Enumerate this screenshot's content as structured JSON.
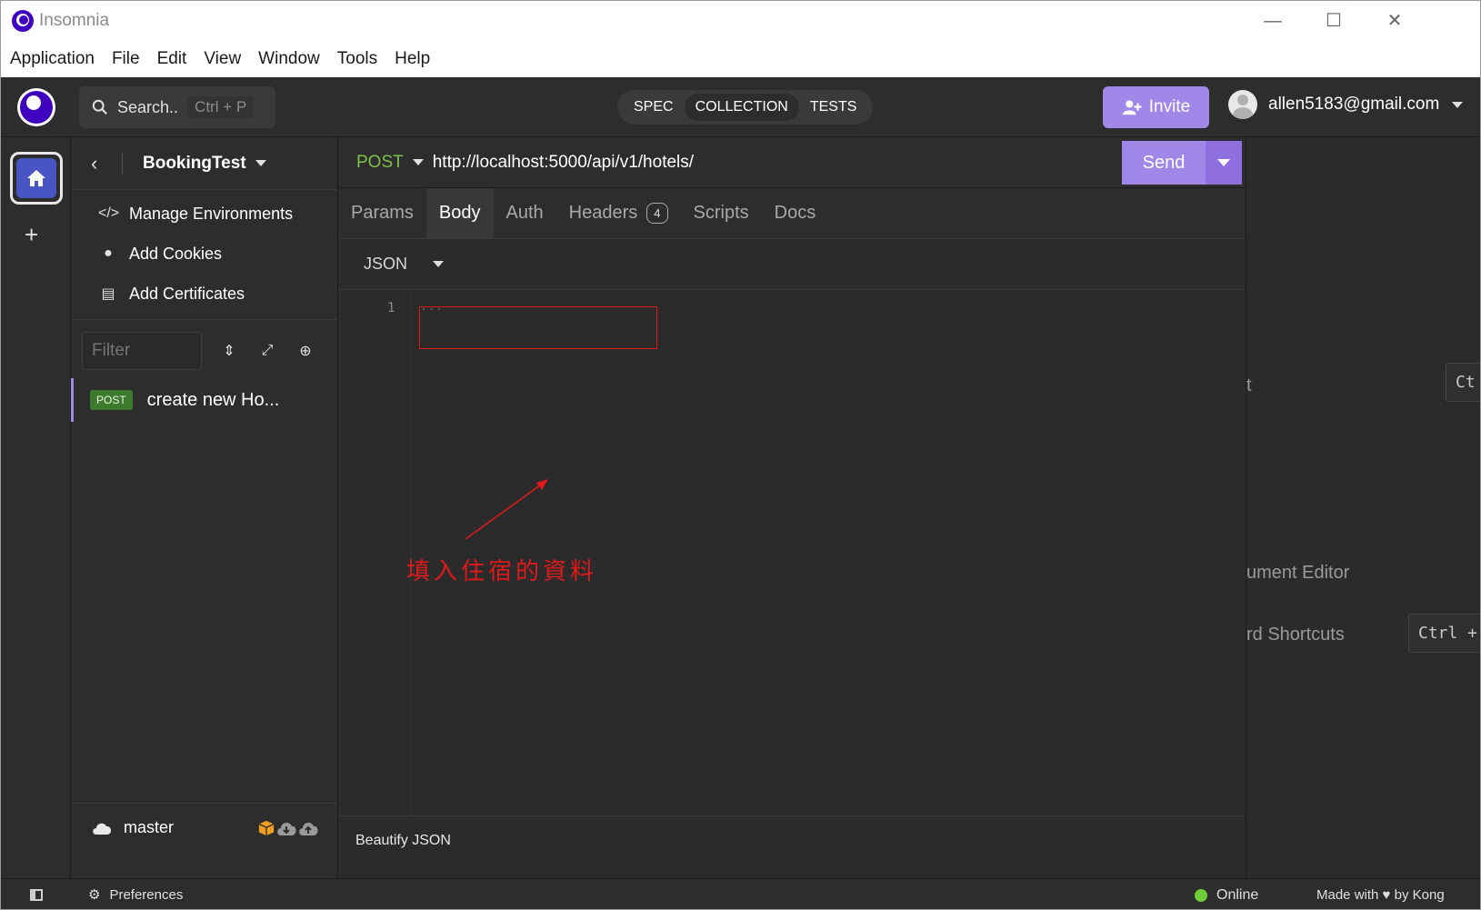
{
  "window": {
    "title": "Insomnia",
    "controls": {
      "minimize": "—",
      "maximize": "☐",
      "close": "✕"
    }
  },
  "menubar": [
    "Application",
    "File",
    "Edit",
    "View",
    "Window",
    "Tools",
    "Help"
  ],
  "header": {
    "search_label": "Search..",
    "search_shortcut": "Ctrl + P",
    "mode_tabs": [
      "SPEC",
      "COLLECTION",
      "TESTS"
    ],
    "active_mode": "COLLECTION",
    "invite_label": "Invite",
    "user_email": "allen5183@gmail.com"
  },
  "sidebar": {
    "project_name": "BookingTest",
    "actions": [
      {
        "label": "Manage Environments",
        "icon": "code-icon"
      },
      {
        "label": "Add Cookies",
        "icon": "cookie-icon"
      },
      {
        "label": "Add Certificates",
        "icon": "certificate-icon"
      }
    ],
    "filter_placeholder": "Filter",
    "requests": [
      {
        "method": "POST",
        "name": "create new Ho..."
      }
    ],
    "branch": "master"
  },
  "request": {
    "method": "POST",
    "url": "http://localhost:5000/api/v1/hotels/",
    "send_label": "Send",
    "tabs": [
      {
        "label": "Params"
      },
      {
        "label": "Body",
        "active": true
      },
      {
        "label": "Auth"
      },
      {
        "label": "Headers",
        "count": "4"
      },
      {
        "label": "Scripts"
      },
      {
        "label": "Docs"
      }
    ],
    "body_type": "JSON",
    "editor": {
      "line_number": "1",
      "placeholder": "..."
    },
    "annotation": "填入住宿的資料",
    "footer_action": "Beautify JSON"
  },
  "response_pane": {
    "fragments": [
      "t",
      "ument Editor",
      "rd Shortcuts"
    ],
    "kbd_fragments": [
      "Ct",
      "Ctrl +"
    ]
  },
  "statusbar": {
    "preferences_label": "Preferences",
    "status_label": "Online",
    "made_with_prefix": "Made with",
    "made_with_suffix": "by Kong"
  },
  "colors": {
    "accent": "#a088e8",
    "method_post": "#7ec14a",
    "annotation_red": "#e01a1a",
    "online_green": "#6fcf3a"
  }
}
